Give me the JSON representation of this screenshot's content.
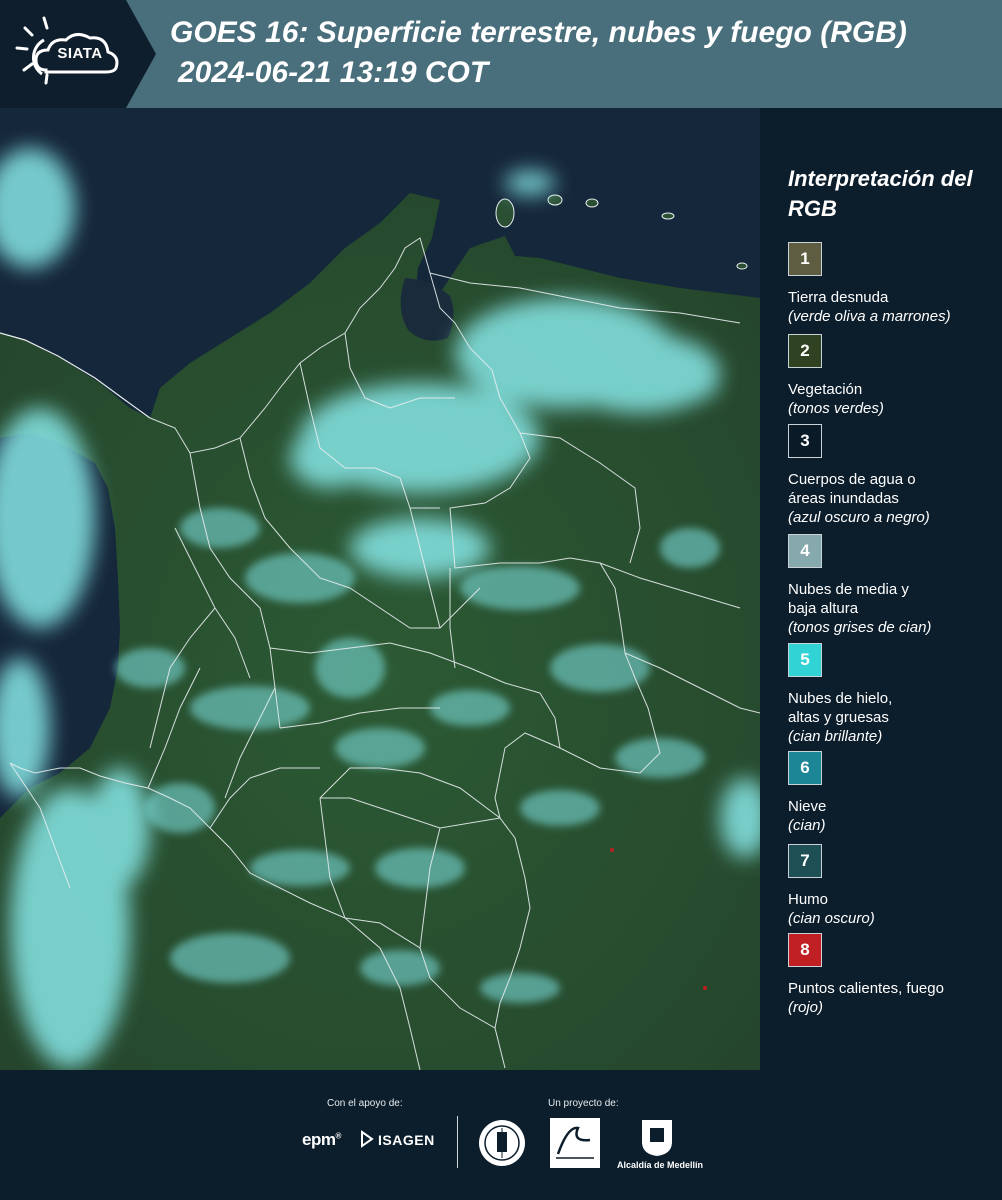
{
  "header": {
    "logo_text": "SIATA",
    "title": "GOES 16: Superficie terrestre, nubes y fuego (RGB)",
    "timestamp": "2024-06-21 13:19 COT",
    "background_color": "#4a6f7c"
  },
  "map": {
    "product": "GeoColor RGB",
    "land_color": "#2f5a3a",
    "water_color": "#17283a",
    "cloud_color": "#7fe3e4",
    "border_color": "#e8eef0"
  },
  "legend": {
    "title": "Interpretación del RGB",
    "items": [
      {
        "number": "1",
        "label": "Tierra desnuda",
        "desc": "(verde oliva a marrones)",
        "color": "#5e5d41"
      },
      {
        "number": "2",
        "label": "Vegetación",
        "desc": "(tonos verdes)",
        "color": "#2f4323"
      },
      {
        "number": "3",
        "label": "Cuerpos de agua o\náreas inundadas",
        "desc": "(azul oscuro a negro)",
        "color": "#0b1a27"
      },
      {
        "number": "4",
        "label": "Nubes de media y\nbaja altura",
        "desc": "(tonos grises de cian)",
        "color": "#86a9ad"
      },
      {
        "number": "5",
        "label": "Nubes de hielo,\naltas y gruesas",
        "desc": "(cian brillante)",
        "color": "#32d3d4"
      },
      {
        "number": "6",
        "label": "Nieve",
        "desc": "(cian)",
        "color": "#1c8596"
      },
      {
        "number": "7",
        "label": "Humo",
        "desc": "(cian oscuro)",
        "color": "#1d4f55"
      },
      {
        "number": "8",
        "label": "Puntos calientes, fuego",
        "desc": "(rojo)",
        "color": "#c01f24"
      }
    ]
  },
  "footer": {
    "support_label": "Con el apoyo de:",
    "project_label": "Un proyecto de:",
    "epm": "epm",
    "isagen": "ISAGEN",
    "alcaldia": "Alcaldía de Medellín"
  }
}
